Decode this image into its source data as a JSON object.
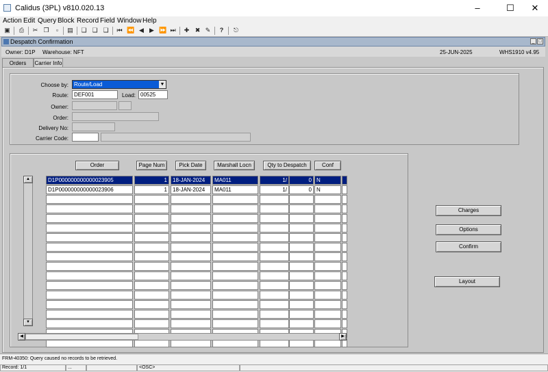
{
  "window": {
    "title": "Calidus (3PL) v810.020.13"
  },
  "menu": [
    "Action",
    "Edit",
    "Query",
    "Block",
    "Record",
    "Field",
    "Window",
    "Help"
  ],
  "toolbar_icons": [
    "save-icon",
    "print-icon",
    "cut-icon",
    "copy-icon",
    "paste-icon",
    "delete-icon",
    "copy-record-icon",
    "duplicate-icon",
    "paste-record-icon",
    "first-record-icon",
    "prev-block-icon",
    "prev-record-icon",
    "next-record-icon",
    "next-block-icon",
    "last-record-icon",
    "insert-record-icon",
    "remove-record-icon",
    "lock-record-icon",
    "help-icon",
    "exit-icon"
  ],
  "form": {
    "title": "Despatch Confirmation"
  },
  "info": {
    "owner_text": "Owner:  D1P",
    "warehouse_text": "Warehouse:  NFT",
    "date": "25-JUN-2025",
    "version": "WHS1910  v4.95"
  },
  "tabs": [
    "Orders",
    "Carrier Info"
  ],
  "fields": {
    "choose_by_label": "Choose by:",
    "choose_by_value": "Route/Load",
    "route_label": "Route:",
    "route_value": "DEF001",
    "load_label": "Load:",
    "load_value": "00525",
    "owner_label": "Owner:",
    "order_label": "Order:",
    "delivery_label": "Delivery No:",
    "carrier_label": "Carrier Code:"
  },
  "table": {
    "headers": [
      "Order",
      "Page Num",
      "Pick Date",
      "Marshall Locn",
      "Qty to Despatch",
      "Conf"
    ],
    "rows": [
      [
        "D1P000000000000023905",
        "1",
        "18-JAN-2024",
        "MA011",
        "1/",
        "0",
        "N"
      ],
      [
        "D1P000000000000023906",
        "1",
        "18-JAN-2024",
        "MA011",
        "1/",
        "0",
        "N"
      ]
    ],
    "empty_rows": 16
  },
  "buttons": {
    "charges": "Charges",
    "options": "Options",
    "confirm": "Confirm",
    "layout": "Layout"
  },
  "status": {
    "message": "FRM-40350:  Query caused no records to be retrieved.",
    "record": "Record: 1/1",
    "dots": "...",
    "osc": "<OSC>"
  },
  "colors": {
    "selection": "#001e80",
    "frame_title": "#a8b8cc"
  }
}
